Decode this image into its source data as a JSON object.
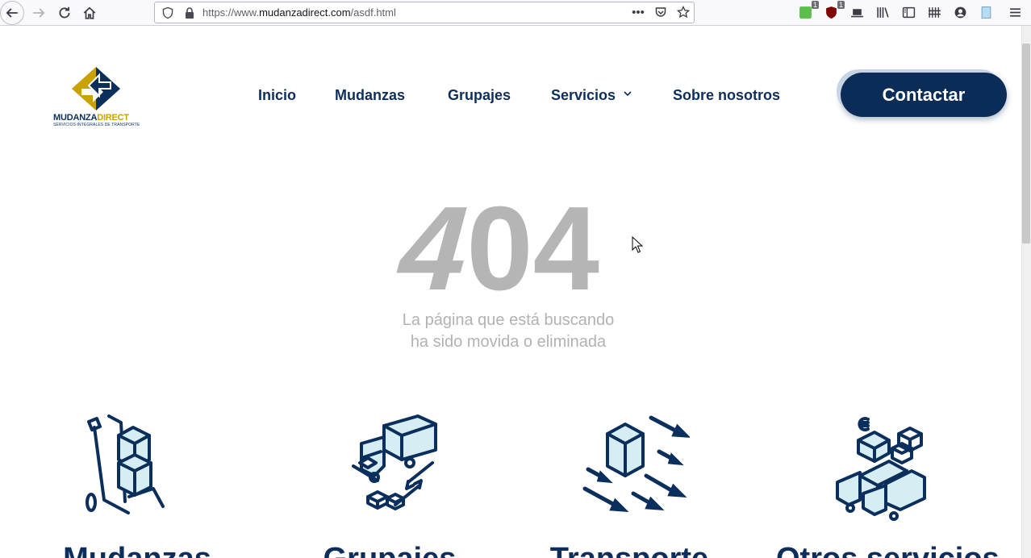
{
  "browser": {
    "url_prefix": "https://www.",
    "url_domain": "mudanzadirect.com",
    "url_path": "/asdf.html",
    "badges": [
      "1",
      "1"
    ],
    "icons": [
      "back-icon",
      "forward-icon",
      "reload-icon",
      "home-icon",
      "shield-icon",
      "lock-icon",
      "more-icon",
      "pocket-icon",
      "bookmark-star-icon",
      "extension-icon",
      "ublock-icon",
      "screenshot-icon",
      "library-icon",
      "sidebar-icon",
      "toolbar-icon",
      "account-icon",
      "notes-icon",
      "menu-icon"
    ]
  },
  "site": {
    "logo": {
      "name_part1": "MUDANZA",
      "name_part2": "DIRECT",
      "tagline": "SERVICIOS INTEGRALES DE TRANSPORTE"
    },
    "nav": [
      "Inicio",
      "Mudanzas",
      "Grupajes",
      "Servicios",
      "Sobre nosotros"
    ],
    "cta": "Contactar",
    "colors": {
      "navy": "#0b2f5c",
      "gold": "#c9a200",
      "gray": "#b5b5b5",
      "light_blue": "#d6eef3"
    }
  },
  "error": {
    "code_first": "4",
    "code_rest": "04",
    "message_line1": "La página que está buscando",
    "message_line2": "ha sido movida o eliminada"
  },
  "services": [
    {
      "title": "Mudanzas",
      "icon": "hand-truck-boxes-icon"
    },
    {
      "title": "Grupajes",
      "icon": "truck-boxes-icon"
    },
    {
      "title": "Transporte",
      "icon": "box-arrows-icon"
    },
    {
      "title": "Otros servicios",
      "icon": "trucks-boxes-euro-icon"
    }
  ]
}
